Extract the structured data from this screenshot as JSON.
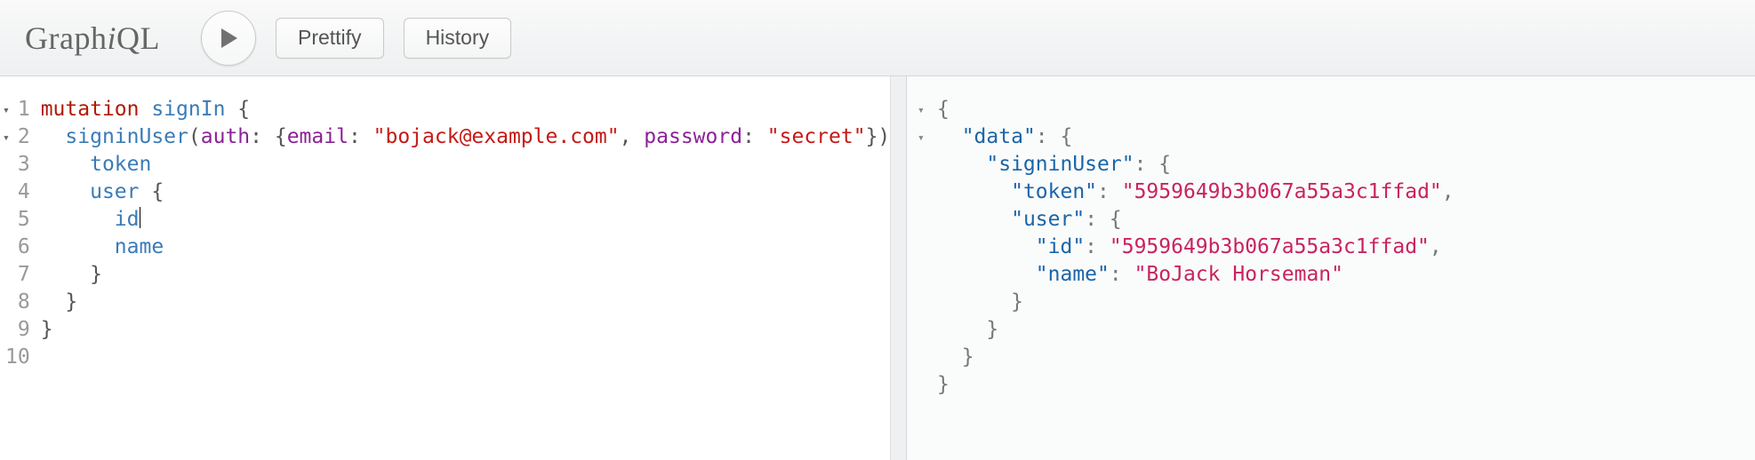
{
  "app": {
    "logo_pre": "Graph",
    "logo_i": "i",
    "logo_post": "QL"
  },
  "toolbar": {
    "prettify_label": "Prettify",
    "history_label": "History"
  },
  "editor": {
    "line_numbers": [
      "1",
      "2",
      "3",
      "4",
      "5",
      "6",
      "7",
      "8",
      "9",
      "10"
    ],
    "folds": {
      "l1": "▾",
      "l2": "▾"
    },
    "code": {
      "kw_mutation": "mutation",
      "op_name": "signIn",
      "field_signin": "signinUser",
      "arg_auth": "auth",
      "arg_email": "email",
      "val_email": "\"bojack@example.com\"",
      "arg_password": "password",
      "val_password": "\"secret\"",
      "field_token": "token",
      "field_user": "user",
      "field_id": "id",
      "field_name": "name"
    }
  },
  "result": {
    "folds": {
      "r1": "▾",
      "r2": "▾"
    },
    "keys": {
      "data": "\"data\"",
      "signinUser": "\"signinUser\"",
      "token": "\"token\"",
      "user": "\"user\"",
      "id": "\"id\"",
      "name": "\"name\""
    },
    "vals": {
      "token": "\"5959649b3b067a55a3c1ffad\"",
      "id": "\"5959649b3b067a55a3c1ffad\"",
      "name": "\"BoJack Horseman\""
    }
  }
}
